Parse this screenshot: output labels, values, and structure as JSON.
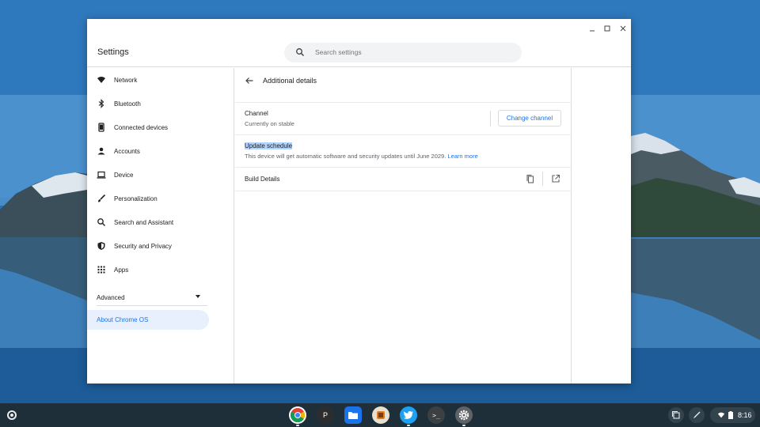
{
  "window": {
    "title": "Settings",
    "controls": [
      "minimize",
      "maximize",
      "close"
    ]
  },
  "search": {
    "placeholder": "Search settings"
  },
  "sidebar": {
    "items": [
      {
        "label": "Network",
        "icon": "wifi-icon"
      },
      {
        "label": "Bluetooth",
        "icon": "bluetooth-icon"
      },
      {
        "label": "Connected devices",
        "icon": "phone-icon"
      },
      {
        "label": "Accounts",
        "icon": "person-icon"
      },
      {
        "label": "Device",
        "icon": "laptop-icon"
      },
      {
        "label": "Personalization",
        "icon": "brush-icon"
      },
      {
        "label": "Search and Assistant",
        "icon": "search-icon"
      },
      {
        "label": "Security and Privacy",
        "icon": "shield-icon"
      },
      {
        "label": "Apps",
        "icon": "apps-grid-icon"
      }
    ],
    "advanced_label": "Advanced",
    "about_label": "About Chrome OS"
  },
  "main": {
    "page_title": "Additional details",
    "channel": {
      "label": "Channel",
      "value": "Currently on stable",
      "button": "Change channel"
    },
    "update": {
      "label": "Update schedule",
      "text": "This device will get automatic software and security updates until June 2029.",
      "link": "Learn more"
    },
    "build": {
      "label": "Build Details"
    }
  },
  "shelf": {
    "apps": [
      "chrome-icon",
      "p-app-icon",
      "files-icon",
      "app-icon",
      "twitter-icon",
      "terminal-icon",
      "settings-icon"
    ],
    "p_app_letter": "P",
    "terminal_glyph": ">_",
    "time": "8:16"
  },
  "colors": {
    "accent": "#1a73e8",
    "selected_bg": "#e8f0fe",
    "highlight": "#b3d4fc",
    "shelf": "#1f2f3a"
  }
}
